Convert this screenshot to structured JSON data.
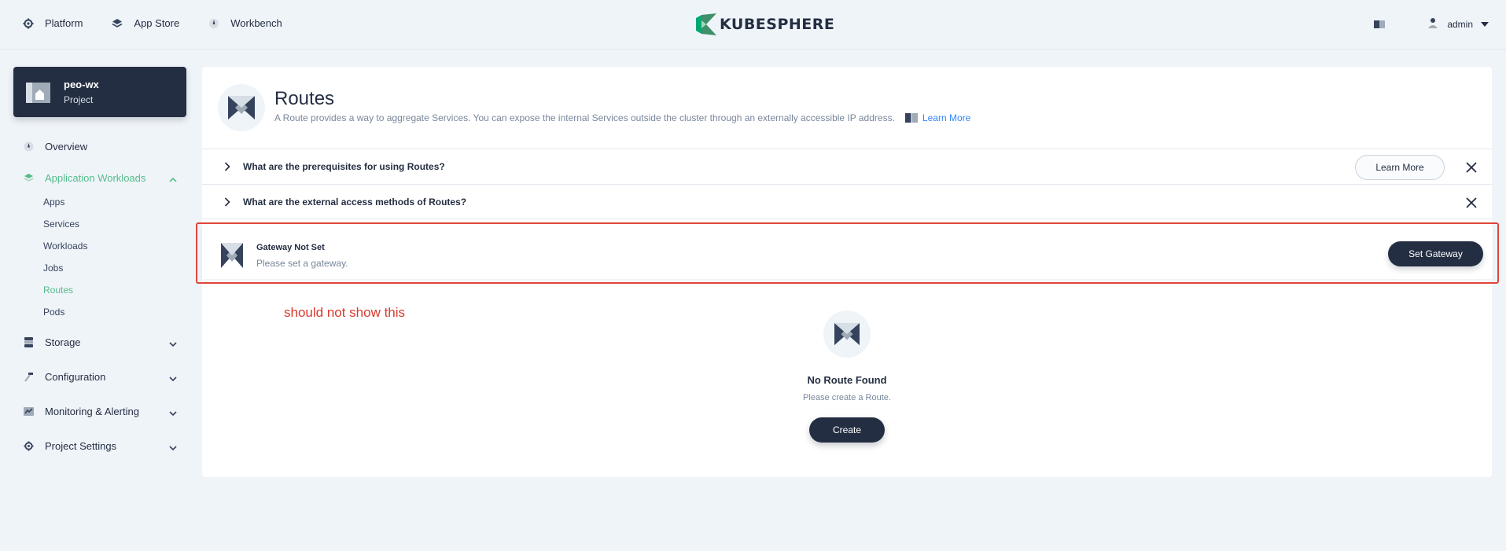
{
  "topbar": {
    "nav": [
      {
        "label": "Platform",
        "icon": "gear-icon"
      },
      {
        "label": "App Store",
        "icon": "layers-icon"
      },
      {
        "label": "Workbench",
        "icon": "dashboard-icon"
      }
    ],
    "logo_text": "KUBESPHERE",
    "user": "admin"
  },
  "project": {
    "name": "peo-wx",
    "type": "Project"
  },
  "sidebar": {
    "overview": "Overview",
    "app_workloads": "Application Workloads",
    "sub_items": [
      "Apps",
      "Services",
      "Workloads",
      "Jobs",
      "Routes",
      "Pods"
    ],
    "active_sub": "Routes",
    "storage": "Storage",
    "configuration": "Configuration",
    "monitoring": "Monitoring & Alerting",
    "project_settings": "Project Settings"
  },
  "banner": {
    "title": "Routes",
    "description": "A Route provides a way to aggregate Services. You can expose the internal Services outside the cluster through an externally accessible IP address.",
    "learn_more": "Learn More"
  },
  "tips": [
    {
      "question": "What are the prerequisites for using Routes?",
      "button": "Learn More"
    },
    {
      "question": "What are the external access methods of Routes?"
    }
  ],
  "gateway": {
    "title": "Gateway Not Set",
    "desc": "Please set a gateway.",
    "button": "Set Gateway"
  },
  "annotation": "should not show this",
  "empty": {
    "title": "No Route Found",
    "desc": "Please create a Route.",
    "button": "Create"
  },
  "colors": {
    "accent": "#55bc8a",
    "dark": "#242e42",
    "annotation_red": "#e0453a"
  }
}
